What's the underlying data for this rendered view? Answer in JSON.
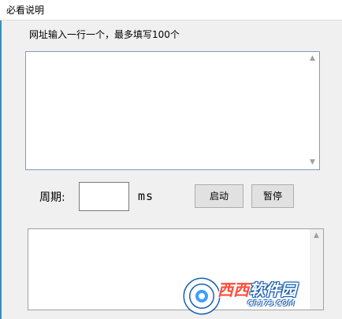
{
  "menu": {
    "item": "必看说明"
  },
  "instruction": "网址输入一行一个，最多填写100个",
  "url_input": {
    "value": ""
  },
  "period": {
    "label": "周期:",
    "value": "",
    "unit": "ms"
  },
  "buttons": {
    "start": "启动",
    "pause": "暂停"
  },
  "log": {
    "value": ""
  },
  "icons": {
    "scroll_up": "scroll-up-icon",
    "scroll_down": "scroll-down-icon",
    "watermark_logo": "cr173-logo-icon"
  },
  "watermark": {
    "brand_highlight": "西西",
    "brand_rest": "软件园",
    "site": "CR173.COM"
  },
  "colors": {
    "window_background": "#f0f0f0",
    "input_border_focus": "#7a9cc8",
    "button_face": "#e1e1e1",
    "watermark_blue": "#1a5fb4"
  }
}
